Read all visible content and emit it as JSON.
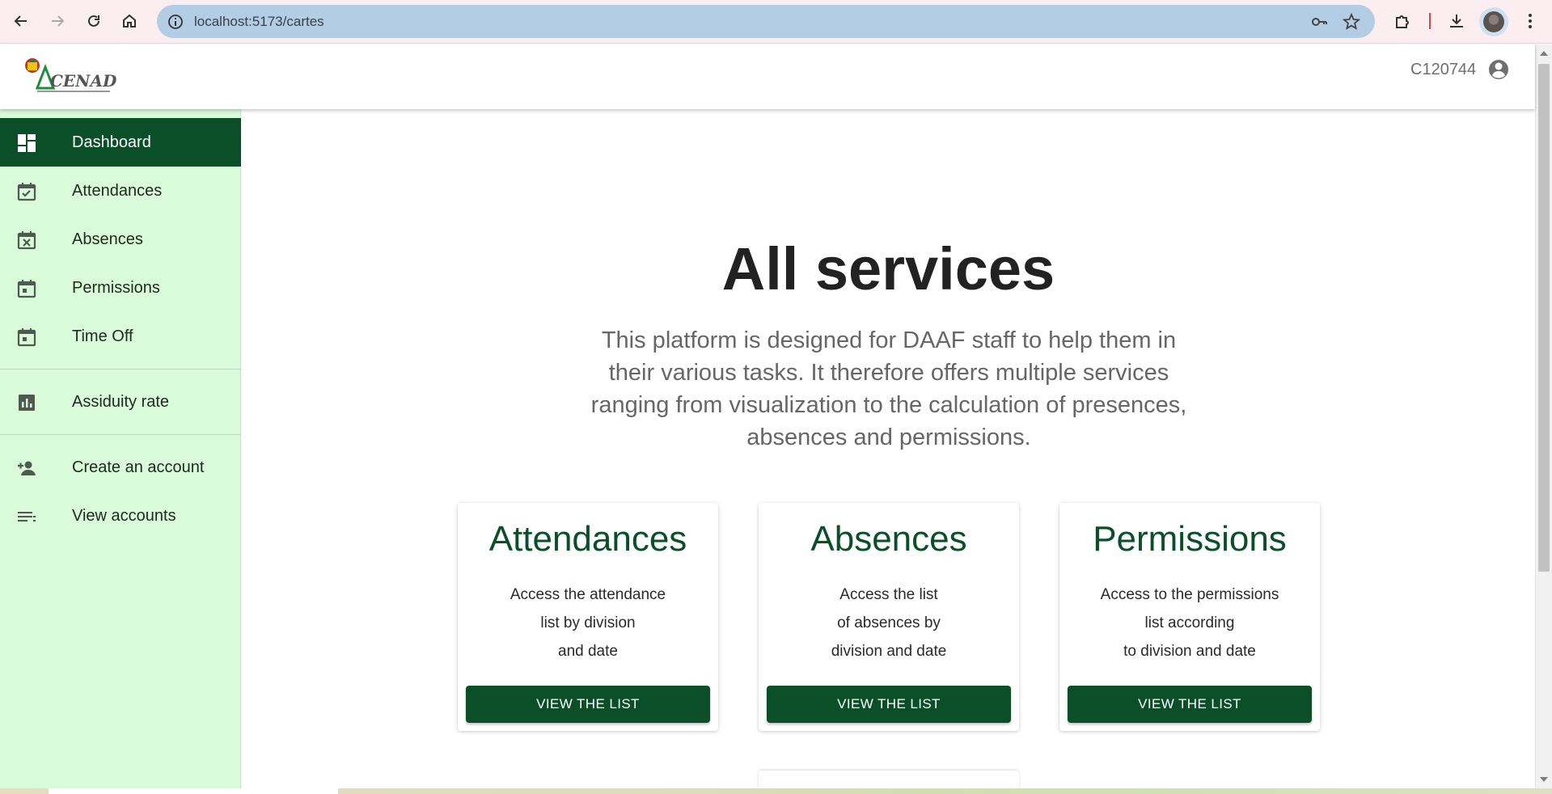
{
  "browser": {
    "url": "localhost:5173/cartes",
    "back_icon": "arrow-left-icon",
    "forward_icon": "arrow-right-icon",
    "reload_icon": "reload-icon",
    "home_icon": "home-icon",
    "omnibox_color": "#b3cde4",
    "chrome_color": "#fbeef0"
  },
  "header": {
    "logo_text": "CENADI",
    "user_id": "C120744"
  },
  "sidebar": {
    "background": "#dafbd9",
    "active_color": "#0b4f29",
    "items": [
      {
        "label": "Dashboard",
        "icon": "dashboard-icon",
        "active": true
      },
      {
        "label": "Attendances",
        "icon": "calendar-check-icon"
      },
      {
        "label": "Absences",
        "icon": "calendar-x-icon"
      },
      {
        "label": "Permissions",
        "icon": "calendar-today-icon"
      },
      {
        "label": "Time Off",
        "icon": "calendar-today-icon"
      },
      {
        "label": "Assiduity rate",
        "icon": "bar-chart-icon"
      },
      {
        "label": "Create an account",
        "icon": "person-add-icon"
      },
      {
        "label": "View accounts",
        "icon": "list-icon"
      }
    ]
  },
  "main": {
    "title": "All services",
    "description": "This platform is designed for DAAF staff to help them in their various tasks. It therefore offers multiple services ranging from visualization to the calculation of presences, absences and permissions.",
    "cards": [
      {
        "title": "Attendances",
        "description": "Access the attendance\nlist by division\nand date",
        "button": "VIEW THE LIST"
      },
      {
        "title": "Absences",
        "description": "Access the list\nof absences by\ndivision and date",
        "button": "VIEW THE LIST"
      },
      {
        "title": "Permissions",
        "description": "Access to the permissions\nlist according\nto division and date",
        "button": "VIEW THE LIST"
      }
    ]
  }
}
